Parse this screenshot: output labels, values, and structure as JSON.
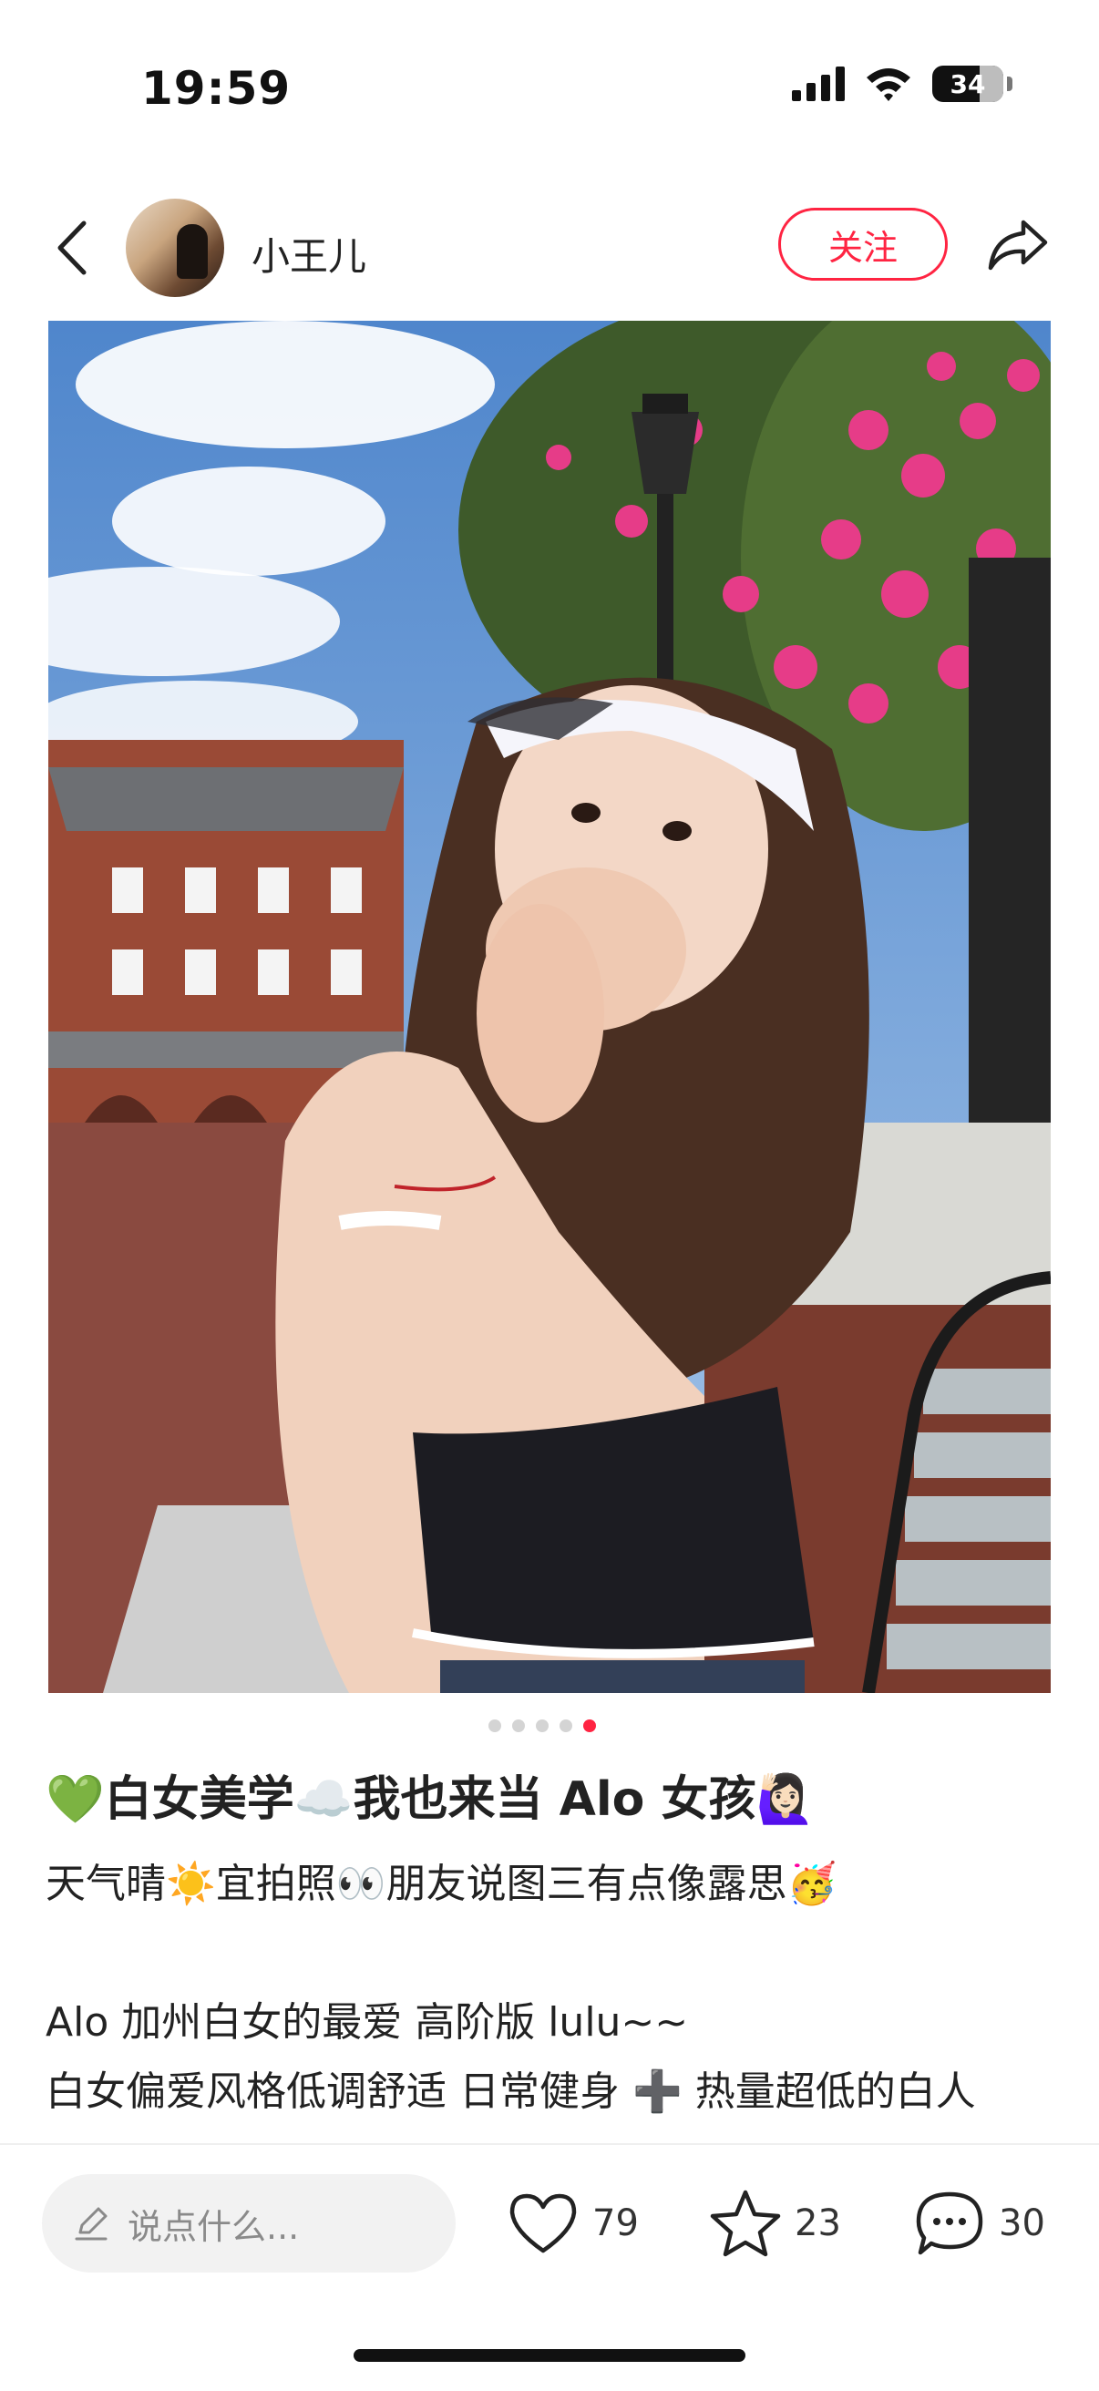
{
  "status_bar": {
    "time": "19:59",
    "battery": "34"
  },
  "author": {
    "name": "小王儿",
    "follow_label": "关注"
  },
  "carousel": {
    "total": 5,
    "active_index": 4
  },
  "post": {
    "title": "💚白女美学☁️我也来当 Alo 女孩🙋🏻‍♀️",
    "body_lines": [
      "天气晴☀️宜拍照👀朋友说图三有点像露思🥳",
      "",
      "Alo 加州白女的最爱 高阶版 lulu~~",
      "白女偏爱风格低调舒适 日常健身 ➕ 热量超低的白人"
    ]
  },
  "bottom_bar": {
    "comment_placeholder": "说点什么...",
    "likes": "79",
    "collects": "23",
    "comments": "30"
  },
  "colors": {
    "accent": "#ff2442"
  }
}
